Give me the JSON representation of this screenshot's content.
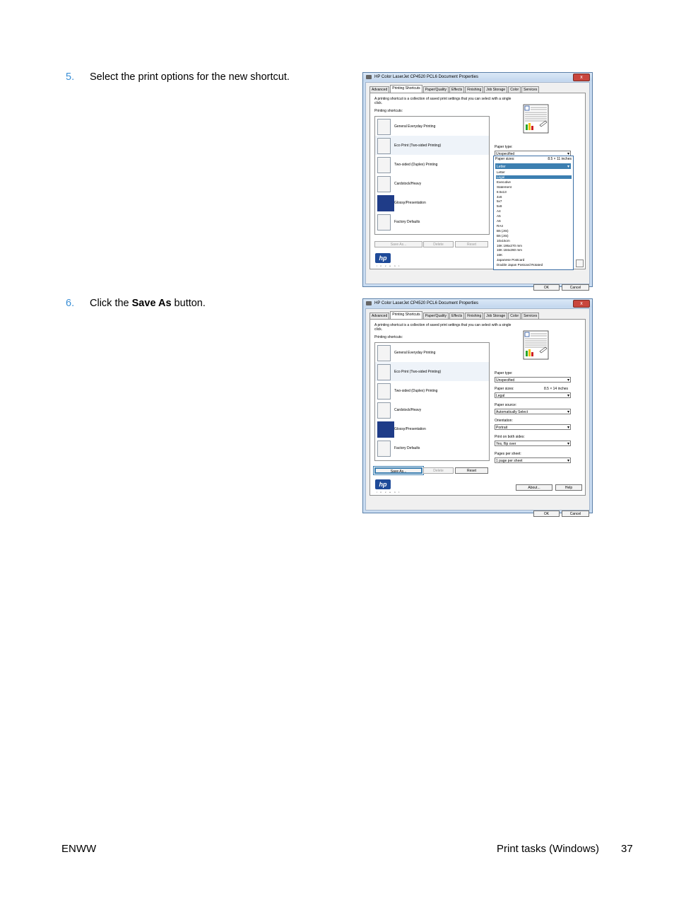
{
  "steps": [
    {
      "number": "5.",
      "text": "Select the print options for the new shortcut."
    },
    {
      "number": "6.",
      "pre": "Click the ",
      "bold": "Save As",
      "post": " button."
    }
  ],
  "dialog": {
    "title": "HP Color LaserJet CP4520 PCL6 Document Properties",
    "close_icon": "x",
    "tabs": [
      "Advanced",
      "Printing Shortcuts",
      "Paper/Quality",
      "Effects",
      "Finishing",
      "Job Storage",
      "Color",
      "Services"
    ],
    "description": "A printing shortcut is a collection of saved print settings that you can select with a single click.",
    "shortcuts_label": "Printing shortcuts:",
    "shortcuts": [
      "General Everyday Printing",
      "Eco Print (Two-sided Printing)",
      "Two-sided (Duplex) Printing",
      "Cardstock/Heavy",
      "Glossy/Presentation",
      "Factory Defaults"
    ],
    "save_as": "Save As...",
    "delete": "Delete",
    "reset": "Reset",
    "logo_text": "hp",
    "invent_text": "i n v e n t",
    "paper_type_label": "Paper type:",
    "paper_type_value": "Unspecified",
    "paper_sizes_label": "Paper sizes:",
    "ok": "OK",
    "cancel": "Cancel",
    "about": "About...",
    "help": "Help"
  },
  "shot1": {
    "paper_size_dims": "8.5 × 11 inches",
    "paper_size_value": "Letter",
    "paper_size_options": [
      "Letter",
      "Legal",
      "Executive",
      "Statement",
      "8.5x13",
      "4x6",
      "5x7",
      "5x8",
      "A4",
      "A5",
      "A6",
      "RA4",
      "B5 (JIS)",
      "B6 (JIS)",
      "10x15cm",
      "16K 195x270 mm",
      "16K 184x260 mm",
      "16K",
      "Japanese Postcard",
      "Double Japan Postcard Rotated"
    ],
    "highlighted_option": "Legal"
  },
  "shot2": {
    "paper_size_dims": "8.5 × 14 inches",
    "paper_size_value": "Legal",
    "paper_source_label": "Paper source:",
    "paper_source_value": "Automatically Select",
    "orientation_label": "Orientation:",
    "orientation_value": "Portrait",
    "both_sides_label": "Print on both sides:",
    "both_sides_value": "Yes, flip over",
    "pages_label": "Pages per sheet:",
    "pages_value": "1 page per sheet"
  },
  "footer": {
    "left": "ENWW",
    "right_text": "Print tasks (Windows)",
    "page": "37"
  }
}
